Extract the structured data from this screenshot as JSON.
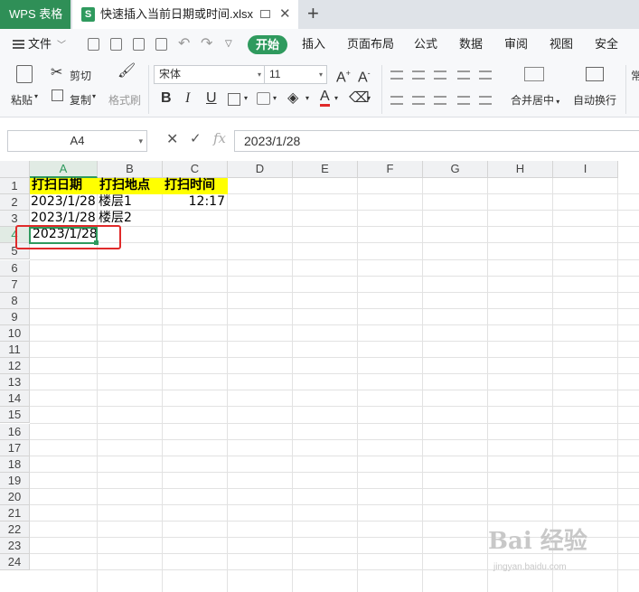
{
  "titlebar": {
    "app_tab": "WPS 表格",
    "doc_icon": "S",
    "doc_tab": "快速插入当前日期或时间.xlsx",
    "close": "✕",
    "new_tab": "+"
  },
  "menu": {
    "file": "文件",
    "tabs": [
      "开始",
      "插入",
      "页面布局",
      "公式",
      "数据",
      "审阅",
      "视图",
      "安全"
    ]
  },
  "ribbon": {
    "paste": "粘贴",
    "cut": "剪切",
    "copy": "复制",
    "format_painter": "格式刷",
    "font_name": "宋体",
    "font_size": "11",
    "bold": "B",
    "italic": "I",
    "underline": "U",
    "font_color_letter": "A",
    "merge_center": "合并居中",
    "wrap_text": "自动换行",
    "cut_off": "常"
  },
  "formula_bar": {
    "name_box": "A4",
    "formula": "2023/1/28",
    "fx": "fx"
  },
  "grid": {
    "columns": [
      "A",
      "B",
      "C",
      "D",
      "E",
      "F",
      "G",
      "H",
      "I"
    ],
    "rows": [
      "1",
      "2",
      "3",
      "4",
      "5",
      "6",
      "7",
      "8",
      "9",
      "10",
      "11",
      "12",
      "13",
      "14",
      "15",
      "16",
      "17",
      "18",
      "19",
      "20",
      "21",
      "22",
      "23",
      "24"
    ],
    "selected_column": "A",
    "selected_row": "4",
    "cells": {
      "A1": "打扫日期",
      "B1": "打扫地点",
      "C1": "打扫时间",
      "A2": "2023/1/28",
      "B2": "楼层1",
      "C2": "12:17",
      "A3": "2023/1/28",
      "B3": "楼层2",
      "A4": "2023/1/28"
    },
    "header_fill": "#ffff00",
    "highlight_color": "#e02a2a",
    "accent": "#2f9a5e"
  },
  "watermark": {
    "brand": "Bai 经验",
    "url": "jingyan.baidu.com"
  }
}
